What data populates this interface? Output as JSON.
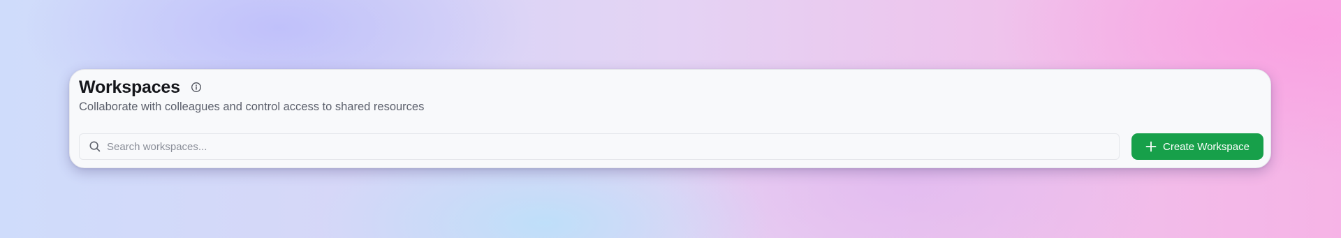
{
  "header": {
    "title": "Workspaces",
    "info_icon": "info-circle-icon",
    "subtitle": "Collaborate with colleagues and control access to shared resources"
  },
  "search": {
    "icon": "search-icon",
    "placeholder": "Search workspaces...",
    "value": ""
  },
  "actions": {
    "create_icon": "plus-icon",
    "create_label": "Create Workspace"
  },
  "colors": {
    "primary_button": "#17a04a",
    "title_text": "#14151a",
    "subtitle_text": "#5b5f6b",
    "placeholder_text": "#8b8f99",
    "card_background": "#f8f9fb"
  }
}
